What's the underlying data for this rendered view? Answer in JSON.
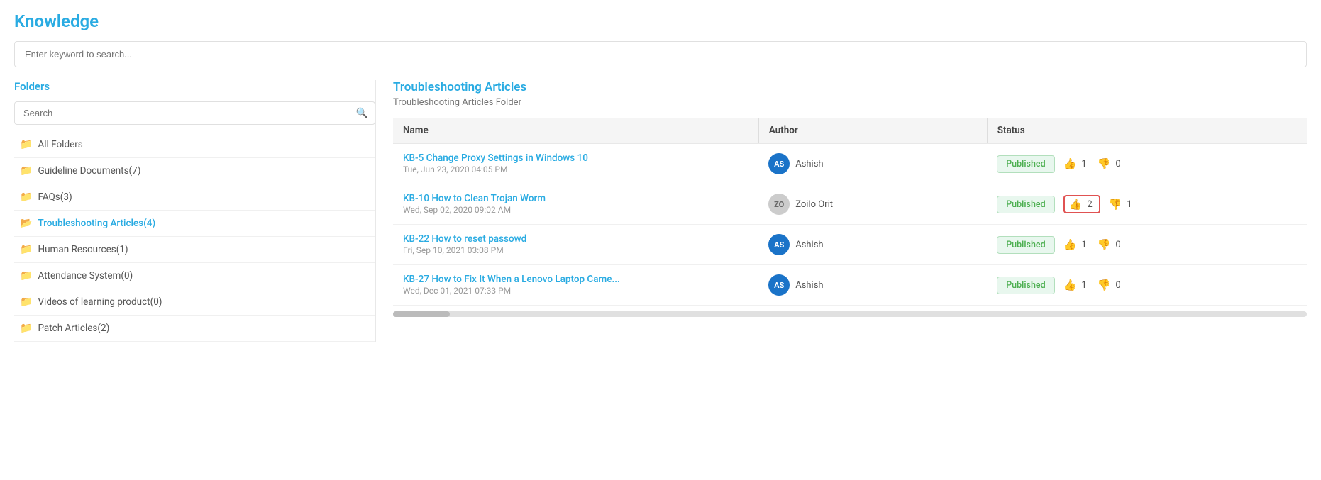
{
  "page": {
    "title": "Knowledge",
    "search_placeholder": "Enter keyword to search..."
  },
  "sidebar": {
    "title": "Folders",
    "search_placeholder": "Search",
    "folders": [
      {
        "id": "all",
        "label": "All Folders",
        "count": null,
        "active": false
      },
      {
        "id": "guideline",
        "label": "Guideline Documents(7)",
        "count": 7,
        "active": false
      },
      {
        "id": "faqs",
        "label": "FAQs(3)",
        "count": 3,
        "active": false
      },
      {
        "id": "troubleshooting",
        "label": "Troubleshooting Articles(4)",
        "count": 4,
        "active": true
      },
      {
        "id": "hr",
        "label": "Human Resources(1)",
        "count": 1,
        "active": false
      },
      {
        "id": "attendance",
        "label": "Attendance System(0)",
        "count": 0,
        "active": false
      },
      {
        "id": "videos",
        "label": "Videos of learning product(0)",
        "count": 0,
        "active": false
      },
      {
        "id": "patch",
        "label": "Patch Articles(2)",
        "count": 2,
        "active": false
      }
    ]
  },
  "content": {
    "title": "Troubleshooting Articles",
    "subtitle": "Troubleshooting Articles Folder",
    "table": {
      "columns": [
        {
          "key": "name",
          "label": "Name"
        },
        {
          "key": "author",
          "label": "Author"
        },
        {
          "key": "status",
          "label": "Status"
        }
      ],
      "rows": [
        {
          "id": 1,
          "name": "KB-5 Change Proxy Settings in Windows 10",
          "date": "Tue, Jun 23, 2020 04:05 PM",
          "author": "Ashish",
          "author_initials": "AS",
          "avatar_type": "blue",
          "status": "Published",
          "thumbs_up": 1,
          "thumbs_down": 0,
          "highlight_votes": false
        },
        {
          "id": 2,
          "name": "KB-10 How to Clean Trojan Worm",
          "date": "Wed, Sep 02, 2020 09:02 AM",
          "author": "Zoilo Orit",
          "author_initials": "ZO",
          "avatar_type": "gray",
          "status": "Published",
          "thumbs_up": 2,
          "thumbs_down": 1,
          "highlight_votes": true
        },
        {
          "id": 3,
          "name": "KB-22 How to reset passowd",
          "date": "Fri, Sep 10, 2021 03:08 PM",
          "author": "Ashish",
          "author_initials": "AS",
          "avatar_type": "blue",
          "status": "Published",
          "thumbs_up": 1,
          "thumbs_down": 0,
          "highlight_votes": false
        },
        {
          "id": 4,
          "name": "KB-27 How to Fix It When a Lenovo Laptop Came...",
          "date": "Wed, Dec 01, 2021 07:33 PM",
          "author": "Ashish",
          "author_initials": "AS",
          "avatar_type": "blue",
          "status": "Published",
          "thumbs_up": 1,
          "thumbs_down": 0,
          "highlight_votes": false
        }
      ]
    }
  }
}
